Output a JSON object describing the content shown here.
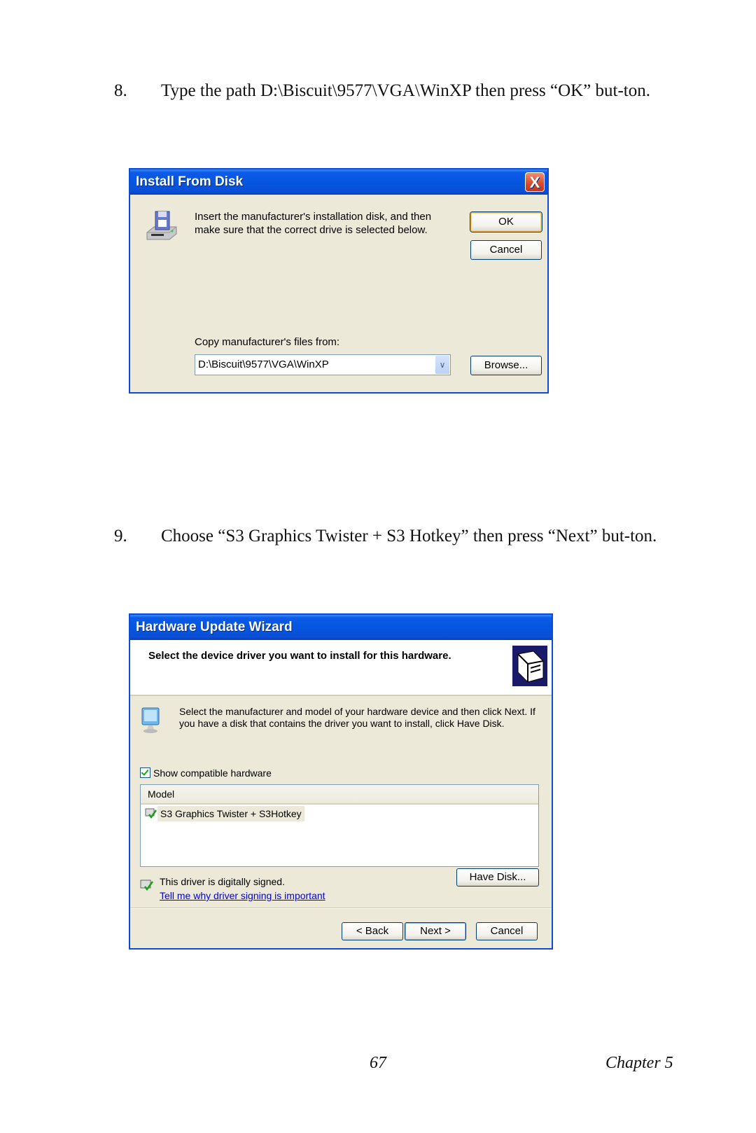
{
  "steps": [
    {
      "number": "8.",
      "text": "Type the path D:\\Biscuit\\9577\\VGA\\WinXP then press “OK” but-ton."
    },
    {
      "number": "9.",
      "text": "Choose “S3 Graphics Twister + S3 Hotkey” then press “Next” but-ton."
    }
  ],
  "install_dialog": {
    "title": "Install From Disk",
    "close_glyph": "X",
    "icon": "floppy-drive-icon",
    "message": "Insert the manufacturer's installation disk, and then make sure that the correct drive is selected below.",
    "ok_label": "OK",
    "cancel_label": "Cancel",
    "copy_label": "Copy manufacturer's files from:",
    "path_value": "D:\\Biscuit\\9577\\VGA\\WinXP",
    "dropdown_glyph": "∨",
    "browse_label": "Browse..."
  },
  "wizard": {
    "title": "Hardware Update Wizard",
    "heading": "Select the device driver you want to install for this hardware.",
    "header_icon": "hardware-icon",
    "description": "Select the manufacturer and model of your hardware device and then click Next. If you have a disk that contains the driver you want to install, click Have Disk.",
    "show_compatible_label": "Show compatible hardware",
    "show_compatible_checked": true,
    "model_column": "Model",
    "models": [
      "S3 Graphics Twister + S3Hotkey"
    ],
    "signed_text": "This driver is digitally signed.",
    "signing_link": "Tell me why driver signing is important",
    "have_disk_label": "Have Disk...",
    "back_label": "< Back",
    "next_label": "Next >",
    "cancel_label": "Cancel"
  },
  "footer": {
    "page_number": "67",
    "chapter": "Chapter 5"
  }
}
